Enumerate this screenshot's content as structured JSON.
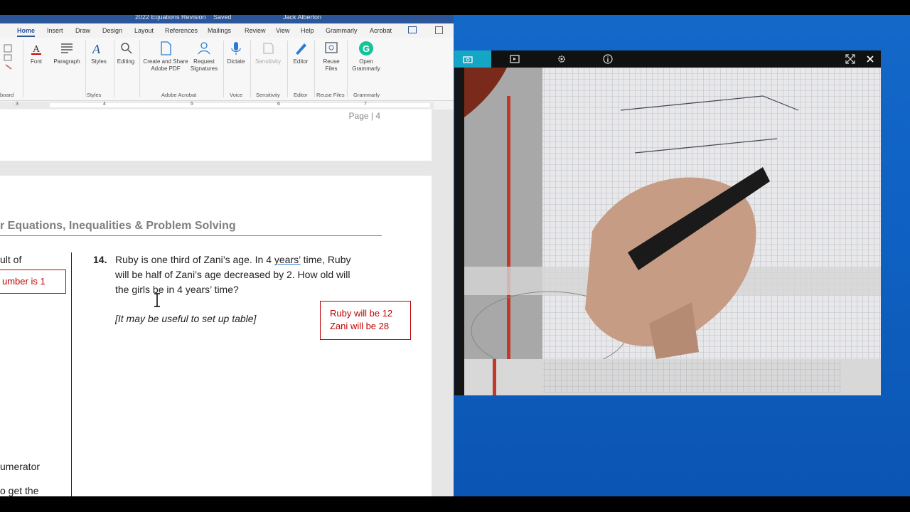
{
  "window": {
    "title": "2022 Equations Revision",
    "saved_status": "Saved",
    "user": "Jack Alberton"
  },
  "ribbon_tabs": [
    "Home",
    "Insert",
    "Draw",
    "Design",
    "Layout",
    "References",
    "Mailings",
    "Review",
    "View",
    "Help",
    "Grammarly",
    "Acrobat"
  ],
  "ribbon": {
    "font": "Font",
    "paragraph": "Paragraph",
    "styles": "Styles",
    "editing": "Editing",
    "create_share_1": "Create and Share",
    "create_share_2": "Adobe PDF",
    "request_1": "Request",
    "request_2": "Signatures",
    "dictate": "Dictate",
    "sensitivity": "Sensitivity",
    "editor": "Editor",
    "reuse_1": "Reuse",
    "reuse_2": "Files",
    "grammarly_1": "Open",
    "grammarly_2": "Grammarly",
    "groups": {
      "clipboard": "board",
      "styles": "Styles",
      "acrobat": "Adobe Acrobat",
      "voice": "Voice",
      "sensitivity": "Sensitivity",
      "editor": "Editor",
      "reuse": "Reuse Files",
      "grammarly": "Grammarly"
    }
  },
  "ruler": [
    "3",
    "4",
    "5",
    "6",
    "7"
  ],
  "document": {
    "page_label": "Page | 4",
    "heading": "r Equations, Inequalities & Problem Solving",
    "left_col": {
      "line1": "ult of",
      "box": "umber is 1",
      "line2": "umerator",
      "line3": "o get the"
    },
    "question": {
      "number": "14.",
      "line1_a": "Ruby is one third of Zani’s age. In 4 ",
      "line1_link": "years’",
      "line1_b": " time, Ruby",
      "line2": "will be half of Zani’s age decreased by 2. How old will",
      "line3": "the girls be in 4 years’ time?",
      "hint": "[It may be useful to set up table]",
      "answer1": "Ruby will be 12",
      "answer2": "Zani will be 28"
    }
  },
  "camera": {
    "icons": [
      "camera-icon",
      "video-icon",
      "settings-icon",
      "info-icon",
      "expand-icon",
      "close-icon"
    ]
  },
  "colors": {
    "word_blue": "#2b579a",
    "camera_accent": "#15a6c5",
    "answer_red": "#c00000",
    "desktop_blue": "#0f62c4"
  }
}
